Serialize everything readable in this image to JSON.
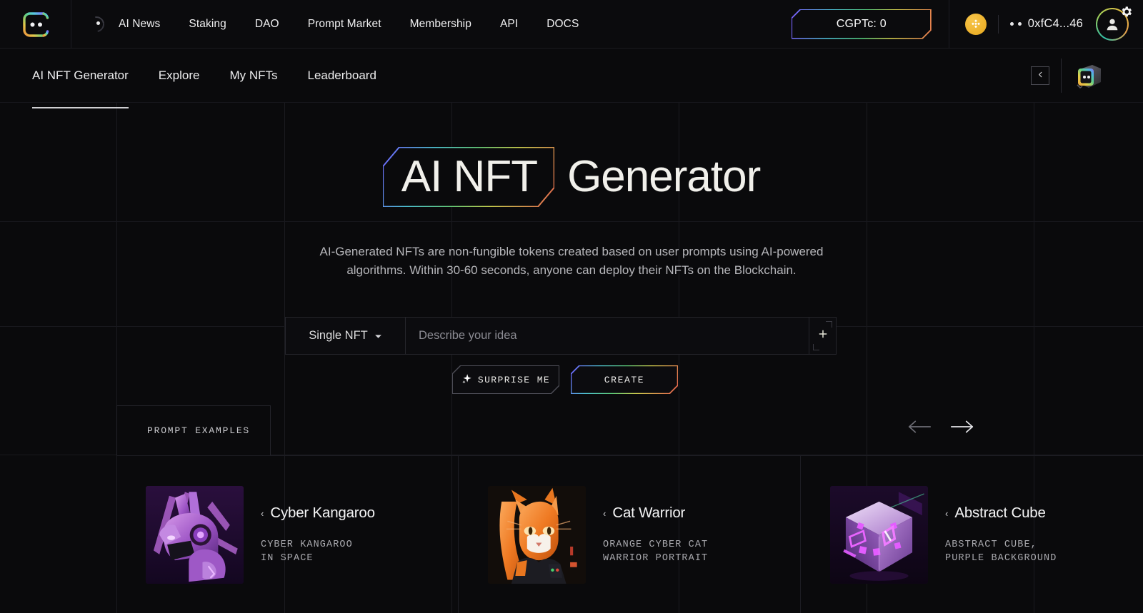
{
  "brand": {
    "logo_icon": "chatgpt-chain-logo-icon",
    "loading_icon": "loading-spinner-icon"
  },
  "topnav": {
    "items": [
      {
        "label": "AI News"
      },
      {
        "label": "Staking"
      },
      {
        "label": "DAO"
      },
      {
        "label": "Prompt Market"
      },
      {
        "label": "Membership"
      },
      {
        "label": "API"
      },
      {
        "label": "DOCS"
      }
    ],
    "credits_label": "CGPTc: 0",
    "chain_icon": "bnb-chain-icon",
    "wallet_address": "0xfC4...46",
    "avatar_icon": "user-avatar-icon",
    "settings_icon": "gear-icon"
  },
  "subnav": {
    "items": [
      {
        "label": "AI NFT Generator",
        "active": true
      },
      {
        "label": "Explore",
        "active": false
      },
      {
        "label": "My NFTs",
        "active": false
      },
      {
        "label": "Leaderboard",
        "active": false
      }
    ],
    "collapse_icon": "chevron-left-icon",
    "bot_cube_icon": "ai-bot-cube-icon"
  },
  "hero": {
    "title_highlight": "AI NFT",
    "title_rest": "Generator",
    "description": "AI-Generated NFTs are non-fungible tokens created based on user prompts using AI-powered algorithms. Within 30-60 seconds, anyone can deploy their NFTs on the Blockchain."
  },
  "prompt_bar": {
    "mode_label": "Single NFT",
    "mode_caret_icon": "chevron-down-icon",
    "input_value": "",
    "input_placeholder": "Describe your idea",
    "add_icon": "plus-icon"
  },
  "actions": {
    "surprise_label": "SURPRISE ME",
    "surprise_icon": "sparkle-icon",
    "create_label": "CREATE"
  },
  "examples_section": {
    "heading": "PROMPT EXAMPLES",
    "prev_icon": "arrow-left-icon",
    "next_icon": "arrow-right-icon",
    "cards": [
      {
        "title": "Cyber Kangaroo",
        "prompt": "CYBER KANGAROO\nIN SPACE",
        "thumb_icon": "cyber-kangaroo-thumbnail"
      },
      {
        "title": "Cat Warrior",
        "prompt": "ORANGE CYBER CAT\nWARRIOR PORTRAIT",
        "thumb_icon": "cat-warrior-thumbnail"
      },
      {
        "title": "Abstract Cube",
        "prompt": "ABSTRACT CUBE,\nPURPLE BACKGROUND",
        "thumb_icon": "abstract-cube-thumbnail"
      }
    ]
  },
  "theme": {
    "background": "#0a0a0c",
    "gradient_start": "#6f5bff",
    "gradient_mid": "#5fd07a",
    "gradient_end": "#e05b4c",
    "accent_amber": "#e8a81c",
    "text_primary": "#f2f2f3",
    "text_muted": "#a9a9ae"
  }
}
